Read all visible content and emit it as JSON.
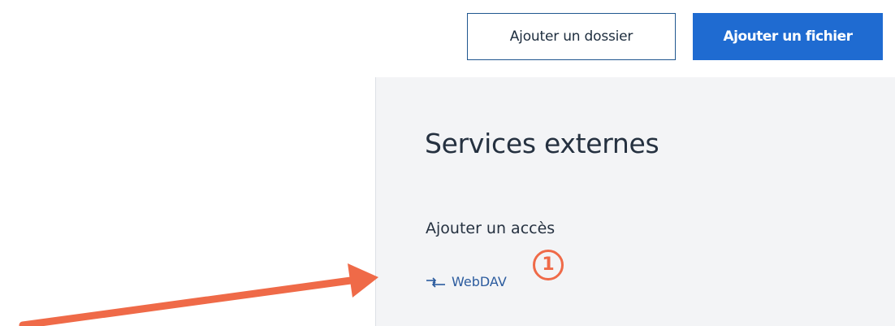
{
  "toolbar": {
    "add_folder_label": "Ajouter un dossier",
    "add_file_label": "Ajouter un fichier"
  },
  "panel": {
    "title": "Services externes",
    "subtitle": "Ajouter un accès",
    "link_label": "WebDAV",
    "link_icon": "transfer-arrows-icon"
  },
  "annotation": {
    "step_number": "1",
    "color": "#ef6a48"
  },
  "colors": {
    "primary": "#1f6bd1",
    "outline": "#20578f",
    "panel_bg": "#f3f4f6",
    "link": "#2b5b9e"
  }
}
